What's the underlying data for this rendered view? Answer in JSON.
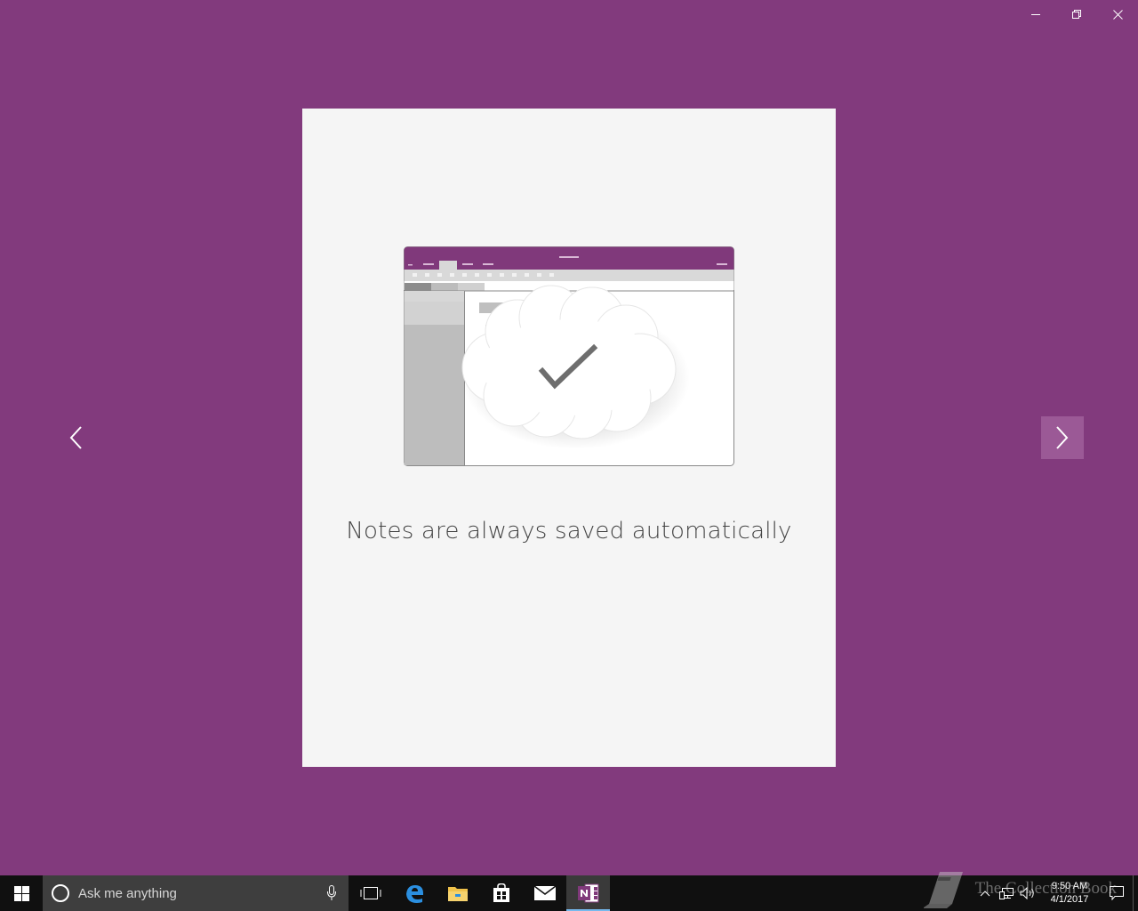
{
  "window": {
    "minimize_icon": "minimize-icon",
    "restore_icon": "restore-icon",
    "close_icon": "close-icon",
    "background_color": "#823A7D"
  },
  "carousel": {
    "caption": "Notes are always saved automatically",
    "prev_icon": "chevron-left-icon",
    "next_icon": "chevron-right-icon",
    "illustration": "onenote-cloud-sync-illustration",
    "card_color": "#F5F5F5"
  },
  "taskbar": {
    "search_placeholder": "Ask me anything",
    "apps": [
      "task-view",
      "edge",
      "file-explorer",
      "store",
      "mail",
      "onenote"
    ],
    "active_app": "onenote",
    "clock_time": "9:50 AM",
    "clock_date": "4/1/2017"
  },
  "watermark": {
    "text": "The Collection Book"
  }
}
